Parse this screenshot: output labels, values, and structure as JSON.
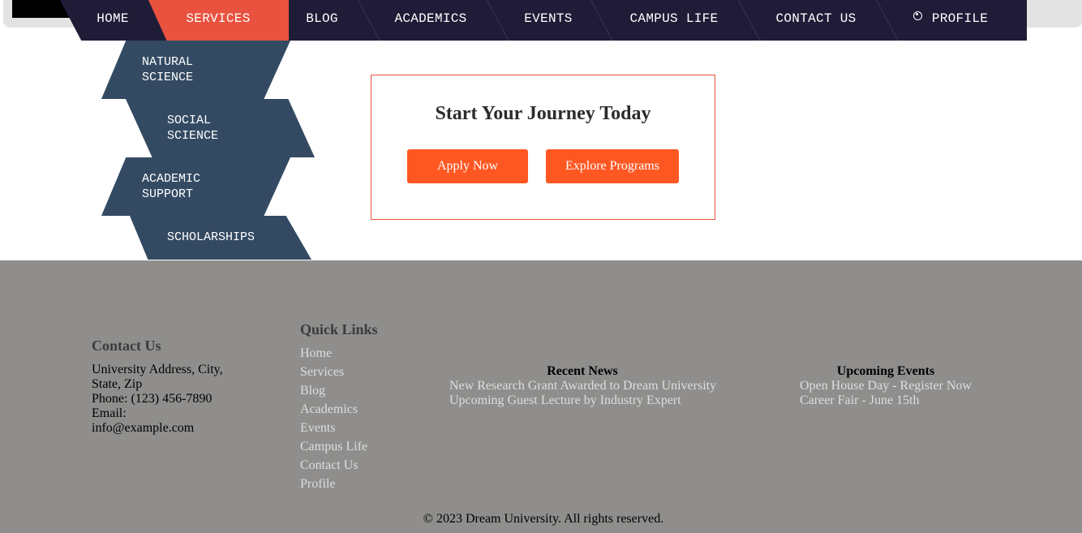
{
  "nav": {
    "items": [
      "HOME",
      "SERVICES",
      "BLOG",
      "ACADEMICS",
      "EVENTS",
      "CAMPUS LIFE",
      "CONTACT US",
      "PROFILE"
    ],
    "active": "SERVICES",
    "colors": {
      "bar": "#201c37",
      "active": "#e8523f"
    }
  },
  "dropdown": {
    "items": [
      {
        "line1": "NATURAL",
        "line2": "SCIENCE"
      },
      {
        "line1": "SOCIAL",
        "line2": "SCIENCE"
      },
      {
        "line1": "ACADEMIC",
        "line2": "SUPPORT"
      },
      {
        "line1": "SCHOLARSHIPS",
        "line2": ""
      }
    ],
    "color": "#334a62"
  },
  "cta": {
    "title": "Start Your Journey Today",
    "apply_label": "Apply Now",
    "explore_label": "Explore Programs",
    "accent": "#ff5722"
  },
  "footer": {
    "contact": {
      "heading": "Contact Us",
      "address1": "University Address, City,",
      "address2": "State, Zip",
      "phone": "Phone: (123) 456-7890",
      "email_label": "Email:",
      "email": "info@example.com"
    },
    "quick_links": {
      "heading": "Quick Links",
      "links": [
        "Home",
        "Services",
        "Blog",
        "Academics",
        "Events",
        "Campus Life",
        "Contact Us",
        "Profile"
      ]
    },
    "news": {
      "heading": "Recent News",
      "items": [
        "New Research Grant Awarded to Dream University",
        "Upcoming Guest Lecture by Industry Expert"
      ]
    },
    "events": {
      "heading": "Upcoming Events",
      "items": [
        "Open House Day - Register Now",
        "Career Fair - June 15th"
      ]
    },
    "copyright": "© 2023 Dream University. All rights reserved.",
    "background": "#8f8e8c"
  }
}
